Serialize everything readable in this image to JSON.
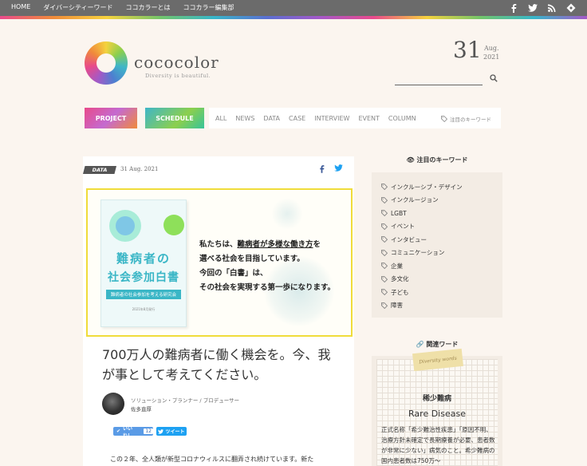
{
  "topnav": [
    "HOME",
    "ダイバーシティーワード",
    "ココカラーとは",
    "ココカラー編集部"
  ],
  "brand": {
    "name": "cococolor",
    "tagline": "Diversity is beautiful."
  },
  "date": {
    "day": "31",
    "month": "Aug.",
    "year": "2021"
  },
  "nav": {
    "project": "PROJECT",
    "schedule": "SCHEDULE",
    "categories": [
      "ALL",
      "NEWS",
      "DATA",
      "CASE",
      "INTERVIEW",
      "EVENT",
      "COLUMN"
    ],
    "keywords_link": "注目のキーワード"
  },
  "article": {
    "tag": "DATA",
    "date": "31 Aug. 2021",
    "hero": {
      "book_title_1": "難病者の",
      "book_title_2": "社会参加白書",
      "book_band": "難病者の社会参加を考える研究会",
      "book_footer": "2021年8月発行",
      "line1_a": "私たちは、",
      "line1_u": "難病者が多様な働き方",
      "line1_b": "を",
      "line2": "選べる社会を目指しています。",
      "line3": "今回の「白書」は、",
      "line4": "その社会を実現する第一歩になります。"
    },
    "title": "700万人の難病者に働く機会を。今、我が事として考えてください。",
    "author_role": "ソリューション・プランナー / プロデューサー",
    "author_name": "佐多直厚",
    "like_label": "いいね！",
    "like_count": "12",
    "tweet_label": "ツイート",
    "body_start": "この２年、全人類が新型コロナウィルスに翻弄され続けています。新た"
  },
  "sidebar": {
    "keywords_title": "注目のキーワード",
    "keywords": [
      "インクルーシブ・デザイン",
      "インクルージョン",
      "LGBT",
      "イベント",
      "インタビュー",
      "コミュニケーション",
      "企業",
      "多文化",
      "子ども",
      "障害"
    ],
    "related_title": "関連ワード",
    "related_tape": "Diversity words",
    "related_word_jp": "稀少難病",
    "related_word_en": "Rare Disease",
    "related_desc": "正式名称「希少難治性疾患」「原因不明、治療方針未確定で長期療養が必要、患者数が非常に少ない」病気のこと。希少難病の国内患者数は750万〜"
  },
  "colors": {
    "topbar": "#6b6b6b",
    "background": "#fbf5ef",
    "accent_yellow": "#f0dc3a",
    "book_teal": "#3ab6c6"
  }
}
